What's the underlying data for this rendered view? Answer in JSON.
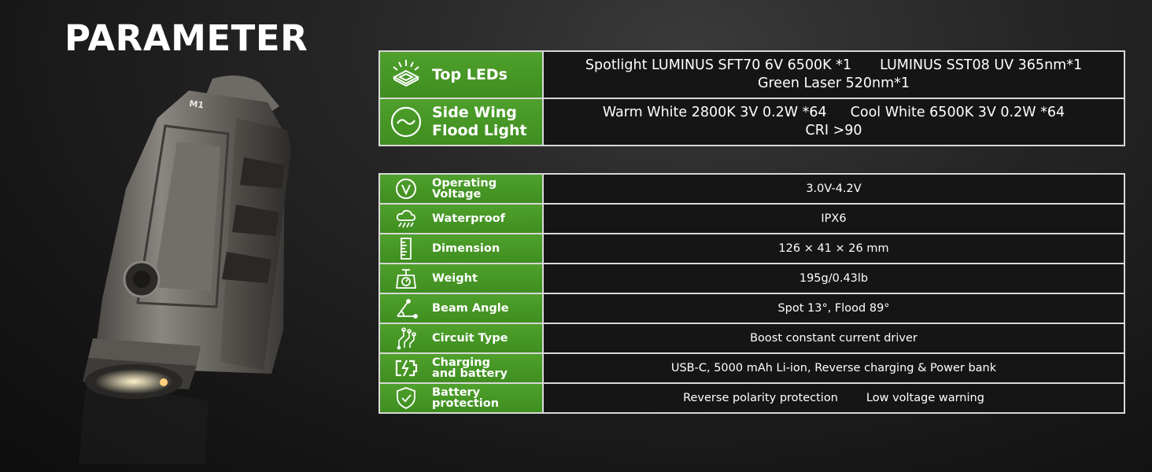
{
  "page": {
    "title": "PARAMETER"
  },
  "product": {
    "model_mark": "M1"
  },
  "top_specs": [
    {
      "icon": "led-chip-icon",
      "label_lines": [
        "Top LEDs"
      ],
      "value_lines": [
        [
          "Spotlight LUMINUS SFT70 6V 6500K *1",
          "LUMINUS SST08 UV 365nm*1"
        ],
        [
          "Green Laser 520nm*1"
        ]
      ]
    },
    {
      "icon": "flood-wave-icon",
      "label_lines": [
        "Side Wing",
        "Flood Light"
      ],
      "value_lines": [
        [
          "Warm White 2800K 3V 0.2W *64",
          "Cool White 6500K 3V 0.2W *64"
        ],
        [
          "CRI >90"
        ]
      ]
    }
  ],
  "specs": [
    {
      "icon": "voltage-icon",
      "label_lines": [
        "Operating",
        "Voltage"
      ],
      "value": [
        "3.0V-4.2V"
      ]
    },
    {
      "icon": "rain-cloud-icon",
      "label_lines": [
        "Waterproof"
      ],
      "value": [
        "IPX6"
      ]
    },
    {
      "icon": "ruler-icon",
      "label_lines": [
        "Dimension"
      ],
      "value": [
        "126 × 41 × 26 mm"
      ]
    },
    {
      "icon": "scale-icon",
      "label_lines": [
        "Weight"
      ],
      "value": [
        "195g/0.43lb"
      ]
    },
    {
      "icon": "angle-icon",
      "label_lines": [
        "Beam Angle"
      ],
      "value": [
        "Spot 13°, Flood 89°"
      ]
    },
    {
      "icon": "circuit-icon",
      "label_lines": [
        "Circuit Type"
      ],
      "value": [
        "Boost constant current driver"
      ]
    },
    {
      "icon": "battery-charging-icon",
      "label_lines": [
        "Charging",
        "and battery"
      ],
      "value": [
        "USB-C, 5000 mAh Li-ion, Reverse charging & Power bank"
      ]
    },
    {
      "icon": "shield-check-icon",
      "label_lines": [
        "Battery",
        "protection"
      ],
      "value": [
        "Reverse polarity protection",
        "Low voltage warning"
      ]
    }
  ],
  "colors": {
    "label_green": "#4a9a28",
    "value_bg": "#151515",
    "border": "#d8d8d8"
  }
}
